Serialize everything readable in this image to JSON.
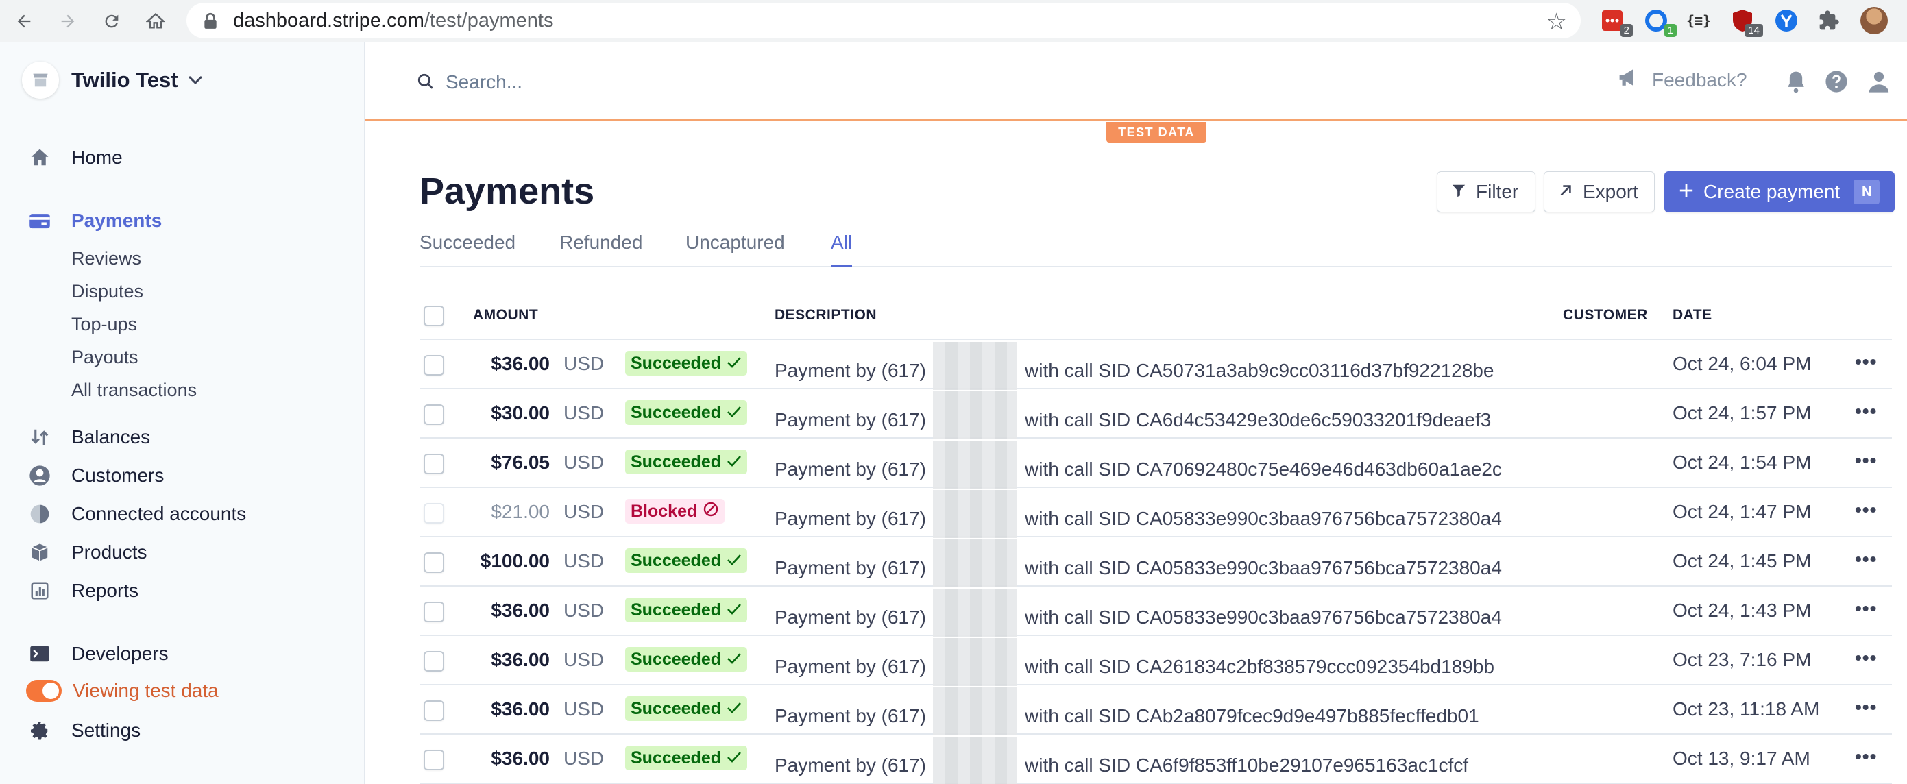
{
  "browser": {
    "url_host": "dashboard.stripe.com",
    "url_path": "/test/payments",
    "extensions": [
      {
        "name": "todo-ext-icon",
        "badge": "2"
      },
      {
        "name": "sync-ext-icon",
        "badge": "1"
      },
      {
        "name": "json-ext-icon",
        "badge": ""
      },
      {
        "name": "shield-ext-icon",
        "badge": "14"
      },
      {
        "name": "y-ext-icon",
        "badge": ""
      },
      {
        "name": "puzzle-icon",
        "badge": ""
      }
    ]
  },
  "sidebar": {
    "account_name": "Twilio Test",
    "items": [
      {
        "label": "Home"
      },
      {
        "label": "Payments"
      },
      {
        "label": "Reviews"
      },
      {
        "label": "Disputes"
      },
      {
        "label": "Top-ups"
      },
      {
        "label": "Payouts"
      },
      {
        "label": "All transactions"
      },
      {
        "label": "Balances"
      },
      {
        "label": "Customers"
      },
      {
        "label": "Connected accounts"
      },
      {
        "label": "Products"
      },
      {
        "label": "Reports"
      },
      {
        "label": "Developers"
      },
      {
        "label": "Viewing test data"
      },
      {
        "label": "Settings"
      }
    ]
  },
  "header": {
    "search_placeholder": "Search...",
    "feedback_label": "Feedback?",
    "test_badge": "TEST DATA"
  },
  "main": {
    "title": "Payments",
    "filter_label": "Filter",
    "export_label": "Export",
    "create_label": "Create payment",
    "create_shortcut": "N",
    "tabs": [
      {
        "label": "Succeeded"
      },
      {
        "label": "Refunded"
      },
      {
        "label": "Uncaptured"
      },
      {
        "label": "All"
      }
    ],
    "active_tab": "All"
  },
  "table": {
    "columns": {
      "amount": "AMOUNT",
      "description": "DESCRIPTION",
      "customer": "CUSTOMER",
      "date": "DATE"
    },
    "rows": [
      {
        "amount": "$36.00",
        "currency": "USD",
        "status": "Succeeded",
        "desc_prefix": "Payment by (617)",
        "desc_suffix": "with call SID CA50731a3ab9c9cc03116d37bf922128be",
        "date": "Oct 24, 6:04 PM"
      },
      {
        "amount": "$30.00",
        "currency": "USD",
        "status": "Succeeded",
        "desc_prefix": "Payment by (617)",
        "desc_suffix": "with call SID CA6d4c53429e30de6c59033201f9deaef3",
        "date": "Oct 24, 1:57 PM"
      },
      {
        "amount": "$76.05",
        "currency": "USD",
        "status": "Succeeded",
        "desc_prefix": "Payment by (617)",
        "desc_suffix": "with call SID CA70692480c75e469e46d463db60a1ae2c",
        "date": "Oct 24, 1:54 PM"
      },
      {
        "amount": "$21.00",
        "currency": "USD",
        "status": "Blocked",
        "desc_prefix": "Payment by (617)",
        "desc_suffix": "with call SID CA05833e990c3baa976756bca7572380a4",
        "date": "Oct 24, 1:47 PM"
      },
      {
        "amount": "$100.00",
        "currency": "USD",
        "status": "Succeeded",
        "desc_prefix": "Payment by (617)",
        "desc_suffix": "with call SID CA05833e990c3baa976756bca7572380a4",
        "date": "Oct 24, 1:45 PM"
      },
      {
        "amount": "$36.00",
        "currency": "USD",
        "status": "Succeeded",
        "desc_prefix": "Payment by (617)",
        "desc_suffix": "with call SID CA05833e990c3baa976756bca7572380a4",
        "date": "Oct 24, 1:43 PM"
      },
      {
        "amount": "$36.00",
        "currency": "USD",
        "status": "Succeeded",
        "desc_prefix": "Payment by (617)",
        "desc_suffix": "with call SID CA261834c2bf838579ccc092354bd189bb",
        "date": "Oct 23, 7:16 PM"
      },
      {
        "amount": "$36.00",
        "currency": "USD",
        "status": "Succeeded",
        "desc_prefix": "Payment by (617)",
        "desc_suffix": "with call SID CAb2a8079fcec9d9e497b885fecffedb01",
        "date": "Oct 23, 11:18 AM"
      },
      {
        "amount": "$36.00",
        "currency": "USD",
        "status": "Succeeded",
        "desc_prefix": "Payment by (617)",
        "desc_suffix": "with call SID CA6f9f853ff10be29107e965163ac1cfcf",
        "date": "Oct 13, 9:17 AM"
      }
    ],
    "more_label": "•••"
  },
  "colors": {
    "accent": "#5469d4",
    "test_orange": "#f5915c",
    "success_bg": "#d7f7c2",
    "blocked_bg": "#ffe7f2"
  }
}
